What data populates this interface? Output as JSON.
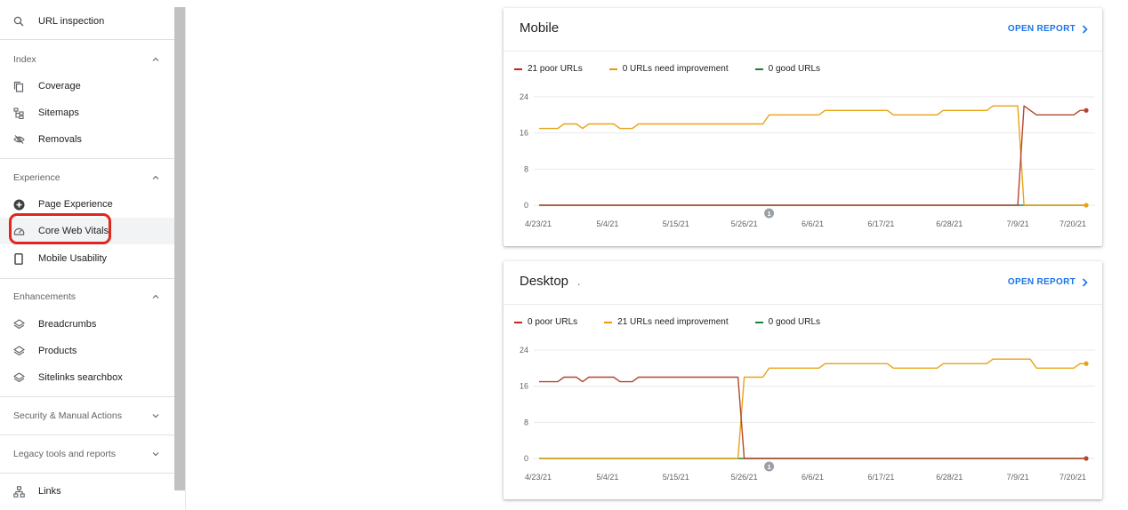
{
  "sidebar": {
    "url_inspection": "URL inspection",
    "index": {
      "heading": "Index",
      "items": [
        "Coverage",
        "Sitemaps",
        "Removals"
      ]
    },
    "experience": {
      "heading": "Experience",
      "items": [
        "Page Experience",
        "Core Web Vitals",
        "Mobile Usability"
      ],
      "active": "Core Web Vitals"
    },
    "enhancements": {
      "heading": "Enhancements",
      "items": [
        "Breadcrumbs",
        "Products",
        "Sitelinks searchbox"
      ]
    },
    "security": "Security & Manual Actions",
    "legacy": "Legacy tools and reports",
    "links": "Links"
  },
  "colors": {
    "poor": "#c5221f",
    "poor_line": "#b3472f",
    "need_improvement": "#f29900",
    "need_improvement_line": "#e8a317",
    "good": "#188038",
    "link": "#1a73e8",
    "highlight": "#e0261f"
  },
  "icons": {
    "url_inspection": "search-icon",
    "coverage": "copy-icon",
    "sitemaps": "sitemap-icon",
    "removals": "eye-off-icon",
    "page_experience": "plus-circle-icon",
    "core_web_vitals": "speedometer-icon",
    "mobile_usability": "phone-icon",
    "enhancements": "layers-icon",
    "links": "network-icon",
    "open_report": "chevron-right-icon"
  },
  "mobile": {
    "title": "Mobile",
    "open_report": "OPEN REPORT",
    "legend": [
      "21 poor URLs",
      "0 URLs need improvement",
      "0 good URLs"
    ]
  },
  "desktop": {
    "title": "Desktop",
    "title_suffix": ".",
    "open_report": "OPEN REPORT",
    "legend": [
      "0 poor URLs",
      "21 URLs need improvement",
      "0 good URLs"
    ]
  },
  "chart_data": [
    {
      "type": "line",
      "x_tick_labels": [
        "4/23/21",
        "5/4/21",
        "5/15/21",
        "5/26/21",
        "6/6/21",
        "6/17/21",
        "6/28/21",
        "7/9/21",
        "7/20/21"
      ],
      "y_ticks": [
        0,
        8,
        16,
        24
      ],
      "ylim": [
        0,
        24
      ],
      "annotation": "1",
      "annotation_date": "5/30/21",
      "series": [
        {
          "name": "21 poor URLs",
          "color": "#b3472f",
          "points": [
            [
              "4/23/21",
              0
            ],
            [
              "7/9/21",
              0
            ],
            [
              "7/10/21",
              22
            ],
            [
              "7/12/21",
              20
            ],
            [
              "7/18/21",
              20
            ],
            [
              "7/19/21",
              21
            ],
            [
              "7/20/21",
              21
            ]
          ]
        },
        {
          "name": "0 URLs need improvement",
          "color": "#e8a317",
          "points": [
            [
              "4/23/21",
              17
            ],
            [
              "4/26/21",
              17
            ],
            [
              "4/27/21",
              18
            ],
            [
              "4/29/21",
              18
            ],
            [
              "4/30/21",
              17
            ],
            [
              "5/1/21",
              18
            ],
            [
              "5/5/21",
              18
            ],
            [
              "5/6/21",
              17
            ],
            [
              "5/8/21",
              17
            ],
            [
              "5/9/21",
              18
            ],
            [
              "5/29/21",
              18
            ],
            [
              "5/30/21",
              20
            ],
            [
              "6/7/21",
              20
            ],
            [
              "6/8/21",
              21
            ],
            [
              "6/18/21",
              21
            ],
            [
              "6/19/21",
              20
            ],
            [
              "6/26/21",
              20
            ],
            [
              "6/27/21",
              21
            ],
            [
              "7/4/21",
              21
            ],
            [
              "7/5/21",
              22
            ],
            [
              "7/9/21",
              22
            ],
            [
              "7/10/21",
              0
            ],
            [
              "7/20/21",
              0
            ]
          ]
        },
        {
          "name": "0 good URLs",
          "color": "#188038",
          "points": [
            [
              "4/23/21",
              0
            ],
            [
              "7/20/21",
              0
            ]
          ]
        }
      ]
    },
    {
      "type": "line",
      "x_tick_labels": [
        "4/23/21",
        "5/4/21",
        "5/15/21",
        "5/26/21",
        "6/6/21",
        "6/17/21",
        "6/28/21",
        "7/9/21",
        "7/20/21"
      ],
      "y_ticks": [
        0,
        8,
        16,
        24
      ],
      "ylim": [
        0,
        24
      ],
      "annotation": "1",
      "annotation_date": "5/30/21",
      "series": [
        {
          "name": "0 poor URLs",
          "color": "#b3472f",
          "points": [
            [
              "4/23/21",
              17
            ],
            [
              "4/26/21",
              17
            ],
            [
              "4/27/21",
              18
            ],
            [
              "4/29/21",
              18
            ],
            [
              "4/30/21",
              17
            ],
            [
              "5/1/21",
              18
            ],
            [
              "5/5/21",
              18
            ],
            [
              "5/6/21",
              17
            ],
            [
              "5/8/21",
              17
            ],
            [
              "5/9/21",
              18
            ],
            [
              "5/25/21",
              18
            ],
            [
              "5/26/21",
              0
            ],
            [
              "7/20/21",
              0
            ]
          ]
        },
        {
          "name": "21 URLs need improvement",
          "color": "#e8a317",
          "points": [
            [
              "4/23/21",
              0
            ],
            [
              "5/25/21",
              0
            ],
            [
              "5/26/21",
              18
            ],
            [
              "5/29/21",
              18
            ],
            [
              "5/30/21",
              20
            ],
            [
              "6/7/21",
              20
            ],
            [
              "6/8/21",
              21
            ],
            [
              "6/18/21",
              21
            ],
            [
              "6/19/21",
              20
            ],
            [
              "6/26/21",
              20
            ],
            [
              "6/27/21",
              21
            ],
            [
              "7/4/21",
              21
            ],
            [
              "7/5/21",
              22
            ],
            [
              "7/11/21",
              22
            ],
            [
              "7/12/21",
              20
            ],
            [
              "7/18/21",
              20
            ],
            [
              "7/19/21",
              21
            ],
            [
              "7/20/21",
              21
            ]
          ]
        },
        {
          "name": "0 good URLs",
          "color": "#188038",
          "points": [
            [
              "4/23/21",
              0
            ],
            [
              "7/20/21",
              0
            ]
          ]
        }
      ]
    }
  ]
}
